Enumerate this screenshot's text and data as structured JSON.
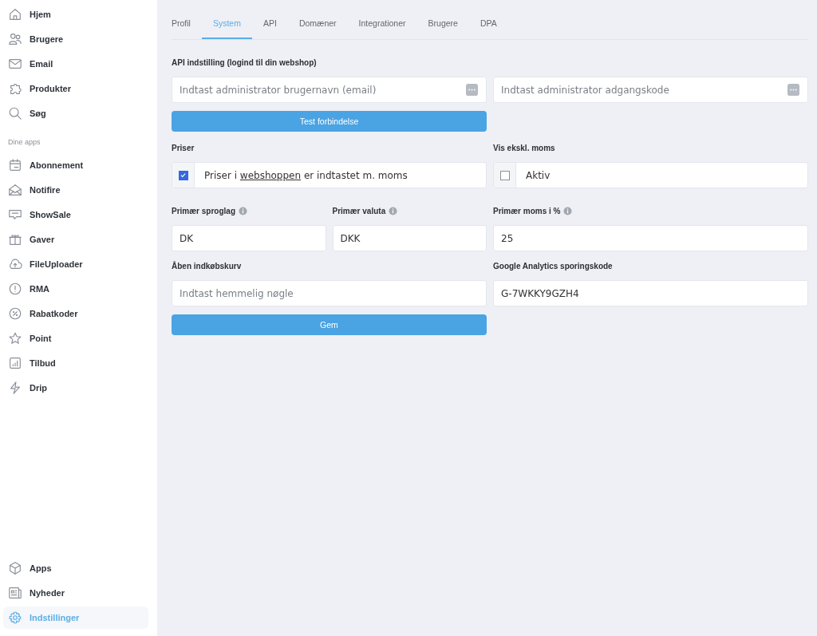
{
  "sidebar": {
    "main_items": [
      {
        "label": "Hjem",
        "selected": false
      },
      {
        "label": "Brugere",
        "selected": false
      },
      {
        "label": "Email",
        "selected": false
      },
      {
        "label": "Produkter",
        "selected": false
      },
      {
        "label": "Søg",
        "selected": false
      }
    ],
    "apps_heading": "Dine apps",
    "app_items": [
      {
        "label": "Abonnement",
        "selected": false
      },
      {
        "label": "Notifire",
        "selected": false
      },
      {
        "label": "ShowSale",
        "selected": false
      },
      {
        "label": "Gaver",
        "selected": false
      },
      {
        "label": "FileUploader",
        "selected": false
      },
      {
        "label": "RMA",
        "selected": false
      },
      {
        "label": "Rabatkoder",
        "selected": false
      },
      {
        "label": "Point",
        "selected": false
      },
      {
        "label": "Tilbud",
        "selected": false
      },
      {
        "label": "Drip",
        "selected": false
      }
    ],
    "bottom_items": [
      {
        "label": "Apps",
        "selected": false
      },
      {
        "label": "Nyheder",
        "selected": false
      },
      {
        "label": "Indstillinger",
        "selected": true
      }
    ]
  },
  "tabs": [
    {
      "label": "Profil",
      "selected": false
    },
    {
      "label": "System",
      "selected": true
    },
    {
      "label": "API",
      "selected": false
    },
    {
      "label": "Domæner",
      "selected": false
    },
    {
      "label": "Integrationer",
      "selected": false
    },
    {
      "label": "Brugere",
      "selected": false
    },
    {
      "label": "DPA",
      "selected": false
    }
  ],
  "api_settings": {
    "heading": "API indstilling (logind til din webshop)",
    "username_field": {
      "placeholder": "Indtast administrator brugernavn (email)"
    },
    "password_field": {
      "placeholder": "Indtast administrator adgangskode"
    },
    "test_button": "Test forbindelse"
  },
  "prices": {
    "label": "Priser",
    "checked": true,
    "text_parts": [
      {
        "text": "Priser i ",
        "link": false
      },
      {
        "text": "webshoppen",
        "link": true
      },
      {
        "text": " er indtastet m. moms",
        "link": false
      }
    ]
  },
  "exclude_vat": {
    "label": "Vis ekskl. moms",
    "checked": false,
    "text_parts": [
      {
        "text": "Aktiv",
        "link": false
      }
    ]
  },
  "language": {
    "label": "Primær sproglag",
    "value": "DK"
  },
  "currency": {
    "label": "Primær valuta",
    "value": "DKK"
  },
  "vat_percent": {
    "label": "Primær moms i %",
    "value": "25"
  },
  "open_cart": {
    "label": "Åben indkøbskurv",
    "placeholder": "Indtast hemmelig nøgle"
  },
  "analytics": {
    "label": "Google Analytics sporingskode",
    "value": "G-7WKKY9GZH4"
  },
  "save_button": "Gem"
}
